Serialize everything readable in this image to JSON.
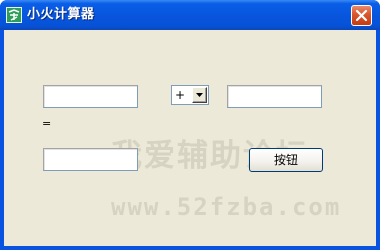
{
  "window": {
    "title": "小火计算器",
    "icon": "app-logo-icon",
    "close_icon": "close-icon",
    "titlebar_color": "#0855dd",
    "client_color": "#ece9d8"
  },
  "form": {
    "input_a": {
      "value": ""
    },
    "operator": {
      "selected": "+"
    },
    "input_b": {
      "value": ""
    },
    "equals_label": "=",
    "result": {
      "value": ""
    },
    "button_label": "按钮"
  },
  "watermark": {
    "text": "我爱辅助论坛",
    "url": "www.52fzba.com"
  }
}
